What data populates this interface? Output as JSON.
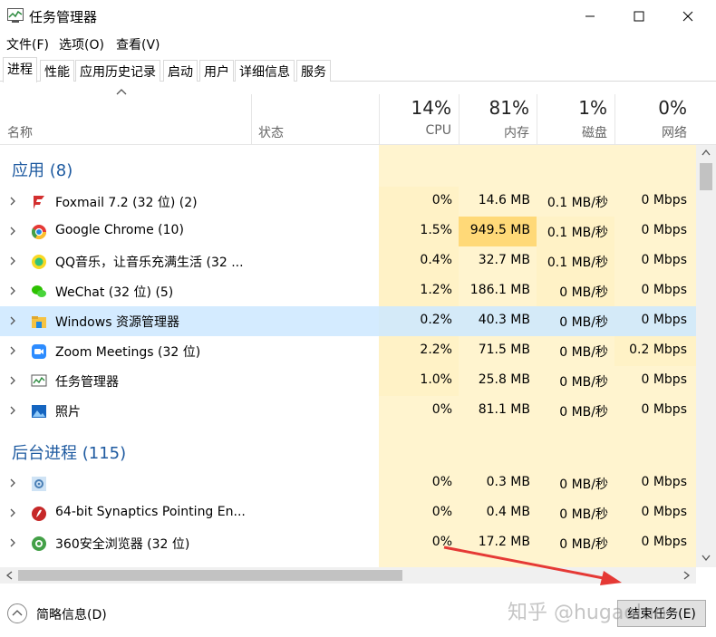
{
  "window": {
    "title": "任务管理器"
  },
  "menu": [
    "文件(F)",
    "选项(O)",
    "查看(V)"
  ],
  "tabs": [
    "进程",
    "性能",
    "应用历史记录",
    "启动",
    "用户",
    "详细信息",
    "服务"
  ],
  "header": {
    "name": "名称",
    "status": "状态",
    "cpu": {
      "pct": "14%",
      "label": "CPU"
    },
    "mem": {
      "pct": "81%",
      "label": "内存"
    },
    "disk": {
      "pct": "1%",
      "label": "磁盘"
    },
    "net": {
      "pct": "0%",
      "label": "网络"
    }
  },
  "groups": {
    "apps": "应用 (8)",
    "background": "后台进程 (115)"
  },
  "rows": [
    {
      "name": "Foxmail 7.2 (32 位) (2)",
      "cpu": "0%",
      "mem": "14.6 MB",
      "disk": "0.1 MB/秒",
      "net": "0 Mbps",
      "icon": "foxmail-icon"
    },
    {
      "name": "Google Chrome (10)",
      "cpu": "1.5%",
      "mem": "949.5 MB",
      "disk": "0.1 MB/秒",
      "net": "0 Mbps",
      "icon": "chrome-icon"
    },
    {
      "name": "QQ音乐，让音乐充满生活 (32 ...",
      "cpu": "0.4%",
      "mem": "32.7 MB",
      "disk": "0.1 MB/秒",
      "net": "0 Mbps",
      "icon": "qqmusic-icon"
    },
    {
      "name": "WeChat (32 位) (5)",
      "cpu": "1.2%",
      "mem": "186.1 MB",
      "disk": "0 MB/秒",
      "net": "0 Mbps",
      "icon": "wechat-icon"
    },
    {
      "name": "Windows 资源管理器",
      "cpu": "0.2%",
      "mem": "40.3 MB",
      "disk": "0 MB/秒",
      "net": "0 Mbps",
      "icon": "explorer-icon"
    },
    {
      "name": "Zoom Meetings (32 位)",
      "cpu": "2.2%",
      "mem": "71.5 MB",
      "disk": "0 MB/秒",
      "net": "0.2 Mbps",
      "icon": "zoom-icon"
    },
    {
      "name": "任务管理器",
      "cpu": "1.0%",
      "mem": "25.8 MB",
      "disk": "0 MB/秒",
      "net": "0 Mbps",
      "icon": "task-manager-icon"
    },
    {
      "name": "照片",
      "cpu": "0%",
      "mem": "81.1 MB",
      "disk": "0 MB/秒",
      "net": "0 Mbps",
      "icon": "photos-icon"
    },
    {
      "name": "",
      "cpu": "0%",
      "mem": "0.3 MB",
      "disk": "0 MB/秒",
      "net": "0 Mbps",
      "icon": "gear-icon"
    },
    {
      "name": "64-bit Synaptics Pointing En...",
      "cpu": "0%",
      "mem": "0.4 MB",
      "disk": "0 MB/秒",
      "net": "0 Mbps",
      "icon": "synaptics-icon"
    },
    {
      "name": "360安全浏览器 (32 位)",
      "cpu": "0%",
      "mem": "17.2 MB",
      "disk": "0 MB/秒",
      "net": "0 Mbps",
      "icon": "browser360-icon"
    }
  ],
  "footer": {
    "summary": "简略信息(D)",
    "end_task": "结束任务(E)",
    "watermark": "知乎 @hugaoluo"
  },
  "colors": {
    "selected_row": "#cce8ff",
    "heat_light": "#fff9e6",
    "heat_mid": "#fff2c6",
    "heat_high": "#ffd978",
    "group_text": "#1e5aa0",
    "annotation_arrow": "#e53935"
  }
}
